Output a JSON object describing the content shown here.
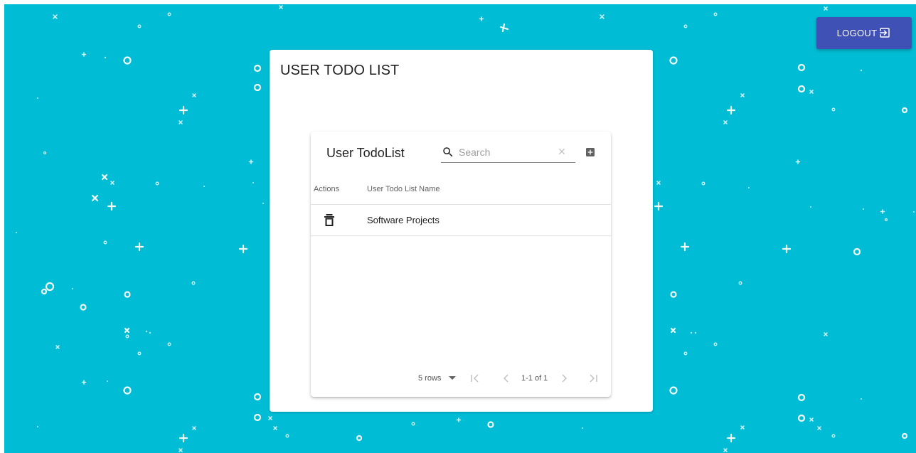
{
  "header": {
    "logout_label": "LOGOUT",
    "logout_icon": "logout-icon"
  },
  "page": {
    "title": "USER TODO LIST"
  },
  "table": {
    "title": "User TodoList",
    "search_placeholder": "Search",
    "search_value": "",
    "columns": [
      "Actions",
      "User Todo List Name"
    ],
    "rows": [
      {
        "name": "Software Projects",
        "action_icon": "trash-icon"
      }
    ],
    "pagination": {
      "rows_per_page": "5 rows",
      "range": "1-1 of 1"
    }
  },
  "colors": {
    "background": "#00bcd4",
    "logout_button": "#3f51b5",
    "card": "#ffffff"
  }
}
